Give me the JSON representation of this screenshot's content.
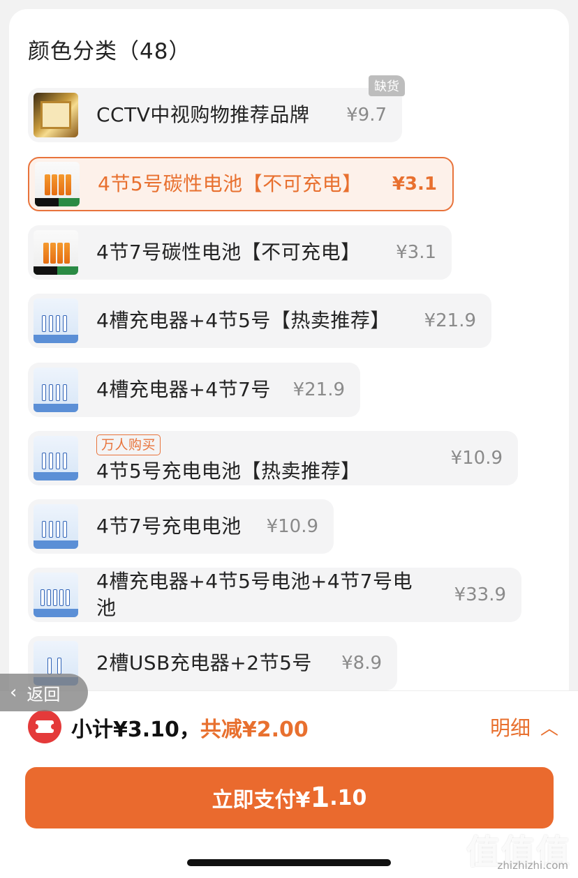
{
  "section": {
    "title": "颜色分类（48）"
  },
  "options": [
    {
      "label": "CCTV中视购物推荐品牌",
      "price": "¥9.7",
      "badge": "缺货"
    },
    {
      "label": "4节5号碳性电池【不可充电】",
      "price": "¥3.1"
    },
    {
      "label": "4节7号碳性电池【不可充电】",
      "price": "¥3.1"
    },
    {
      "label": "4槽充电器+4节5号【热卖推荐】",
      "price": "¥21.9"
    },
    {
      "label": "4槽充电器+4节7号",
      "price": "¥21.9"
    },
    {
      "label": "4节5号充电电池【热卖推荐】",
      "price": "¥10.9",
      "tag": "万人购买"
    },
    {
      "label": "4节7号充电电池",
      "price": "¥10.9"
    },
    {
      "label": "4槽充电器+4节5号电池+4节7号电池",
      "price": "¥33.9"
    },
    {
      "label": "2槽USB充电器+2节5号",
      "price": "¥8.9"
    }
  ],
  "back": {
    "label": "返回"
  },
  "footer": {
    "subtotal": "小计¥3.10，",
    "saved": "共减¥2.00",
    "detail": "明细",
    "pay_prefix": "立即支付¥",
    "pay_int": "1",
    "pay_dec": ".10"
  },
  "watermark": {
    "text": "值值值",
    "url": "zhizhizhi.com"
  },
  "colors": {
    "accent": "#ea6a2e",
    "selected_bg": "#fdf1ea",
    "coupon": "#e43a3a"
  }
}
